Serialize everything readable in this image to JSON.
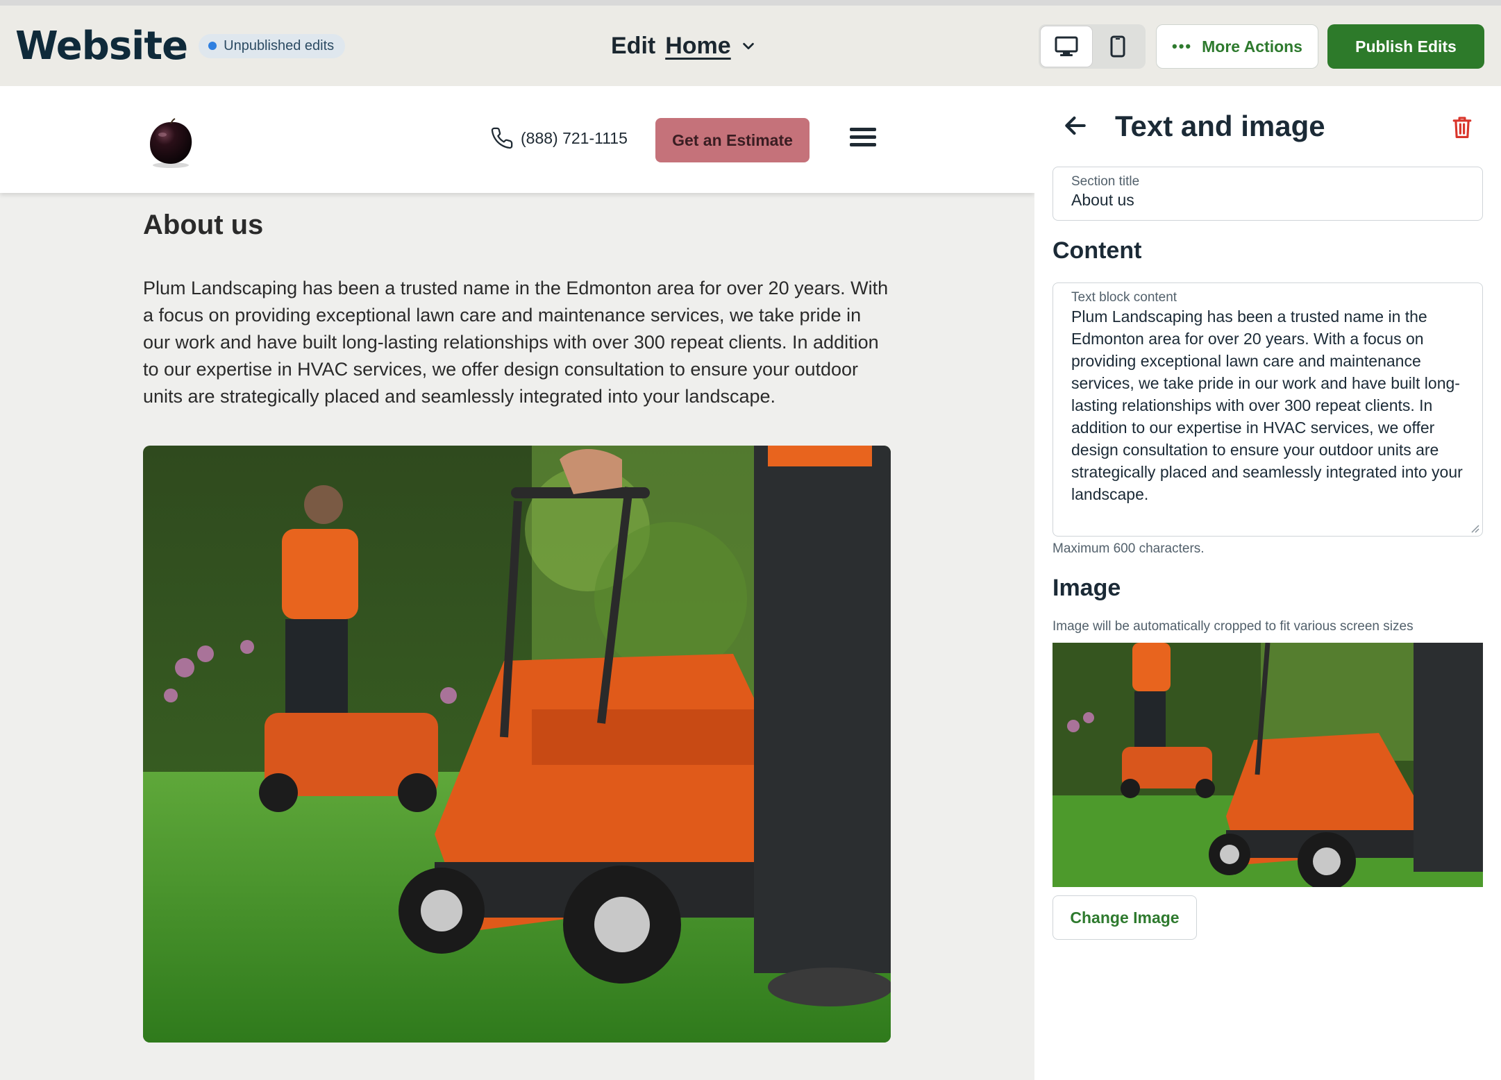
{
  "topbar": {
    "brand": "Website",
    "status_badge": "Unpublished edits",
    "edit_label": "Edit",
    "page_name": "Home",
    "more_actions": "More Actions",
    "publish": "Publish Edits",
    "device_mode": "desktop"
  },
  "site": {
    "phone": "(888) 721-1115",
    "estimate_button": "Get an Estimate",
    "about_title": "About us",
    "about_body": "Plum Landscaping has been a trusted name in the Edmonton area for over 20 years. With a focus on providing exceptional lawn care and maintenance services, we take pride in our work and have built long-lasting relationships with over 300 repeat clients. In addition to our expertise in HVAC services, we offer design consultation to ensure your outdoor units are strategically placed and seamlessly integrated into your landscape."
  },
  "panel": {
    "title": "Text and image",
    "section_title_label": "Section title",
    "section_title_value": "About us",
    "content_heading": "Content",
    "text_block_label": "Text block content",
    "text_block_value": "Plum Landscaping has been a trusted name in the Edmonton area for over 20 years. With a focus on providing exceptional lawn care and maintenance services, we take pride in our work and have built long-lasting relationships with over 300 repeat clients. In addition to our expertise in HVAC services, we offer design consultation to ensure your outdoor units are strategically placed and seamlessly integrated into your landscape.",
    "max_chars_hint": "Maximum 600 characters.",
    "image_heading": "Image",
    "image_hint": "Image will be automatically cropped to fit various screen sizes",
    "change_image": "Change Image"
  },
  "colors": {
    "brand_green": "#2d7a2a",
    "estimate_button": "#c5727a",
    "delete_red": "#d9352b",
    "badge_dot": "#2f7fe0"
  },
  "icons": [
    "desktop-icon",
    "tablet-icon",
    "more-dots-icon",
    "chevron-down-icon",
    "phone-icon",
    "hamburger-icon",
    "back-arrow-icon",
    "trash-icon",
    "plum-logo"
  ]
}
